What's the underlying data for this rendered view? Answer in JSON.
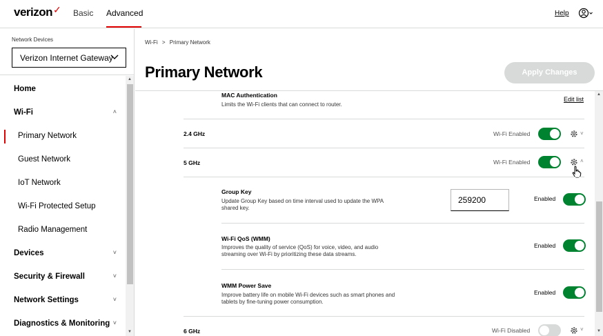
{
  "header": {
    "logo": "verizon",
    "logo_check": "✓",
    "tabs": [
      "Basic",
      "Advanced"
    ],
    "help": "Help"
  },
  "sidebar": {
    "device_label": "Network Devices",
    "device_selected": "Verizon Internet Gateway",
    "items": [
      {
        "label": "Home"
      },
      {
        "label": "Wi-Fi"
      },
      {
        "label": "Primary Network"
      },
      {
        "label": "Guest Network"
      },
      {
        "label": "IoT Network"
      },
      {
        "label": "Wi-Fi Protected Setup"
      },
      {
        "label": "Radio Management"
      },
      {
        "label": "Devices"
      },
      {
        "label": "Security & Firewall"
      },
      {
        "label": "Network Settings"
      },
      {
        "label": "Diagnostics & Monitoring"
      }
    ]
  },
  "main": {
    "breadcrumb": [
      "Wi-Fi",
      "Primary Network"
    ],
    "breadcrumb_sep": ">",
    "title": "Primary Network",
    "apply_label": "Apply Changes",
    "mac": {
      "title": "MAC Authentication",
      "desc": "Limits the Wi-Fi clients that can connect to router.",
      "link": "Edit list"
    },
    "bands": [
      {
        "label": "2.4 GHz",
        "status": "Wi-Fi Enabled",
        "enabled": true
      },
      {
        "label": "5 GHz",
        "status": "Wi-Fi Enabled",
        "enabled": true
      },
      {
        "label": "6 GHz",
        "status": "Wi-Fi Disabled",
        "enabled": false
      }
    ],
    "settings": [
      {
        "title": "Group Key",
        "desc1": "Update Group Key based on time interval used to update the WPA",
        "desc2": "shared key.",
        "value": "259200",
        "status": "Enabled"
      },
      {
        "title": "Wi-Fi QoS (WMM)",
        "desc1": "Improves the quality of service (QoS) for voice, video, and audio",
        "desc2": "streaming over Wi-Fi by prioritizing these data streams.",
        "status": "Enabled"
      },
      {
        "title": "WMM Power Save",
        "desc1": "Improve battery life on mobile Wi-Fi devices such as smart phones and",
        "desc2": "tablets by fine-tuning power consumption.",
        "status": "Enabled"
      }
    ]
  },
  "colors": {
    "accent": "#e00000",
    "toggle_on": "#008331",
    "disabled": "#d8dada"
  }
}
